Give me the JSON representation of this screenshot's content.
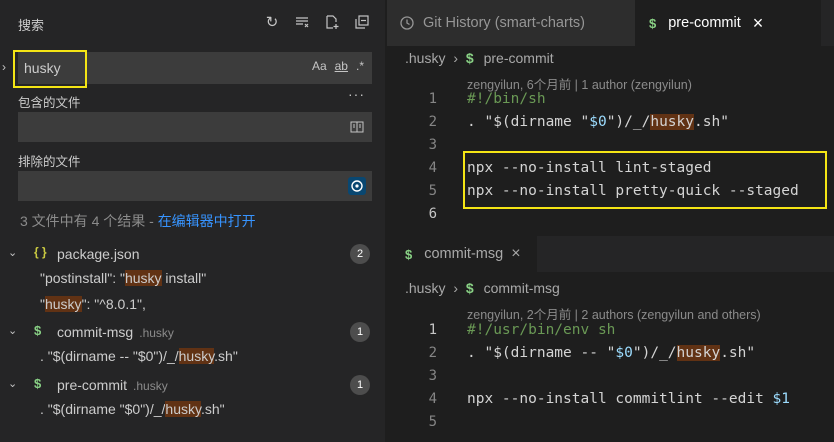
{
  "sidebar": {
    "title": "搜索",
    "actions": [
      {
        "icon": "refresh-icon",
        "glyph": "↻"
      },
      {
        "icon": "clear-results-icon",
        "glyph": "≡"
      },
      {
        "icon": "new-search-editor-icon",
        "glyph": "+"
      },
      {
        "icon": "collapse-all-icon",
        "glyph": "⊟"
      }
    ],
    "search": {
      "value": "husky",
      "options": [
        "Aa",
        "ab",
        ".*"
      ]
    },
    "more_icon": "···",
    "include_label": "包含的文件",
    "exclude_label": "排除的文件",
    "summary": "3 文件中有 4 个结果 - ",
    "summary_link": "在编辑器中打开",
    "results": [
      {
        "icon": "{ }",
        "name": "package.json",
        "dir": "",
        "count": "2",
        "lines": [
          {
            "pre": "\"postinstall\": \"",
            "match": "husky",
            "post": " install\""
          },
          {
            "pre": "\"",
            "match": "husky",
            "post": "\": \"^8.0.1\","
          }
        ]
      },
      {
        "icon": "$",
        "name": "commit-msg",
        "dir": ".husky",
        "count": "1",
        "lines": [
          {
            "pre": ". \"$(dirname -- \"$0\")/_/",
            "match": "husky",
            "post": ".sh\""
          }
        ]
      },
      {
        "icon": "$",
        "name": "pre-commit",
        "dir": ".husky",
        "count": "1",
        "lines": [
          {
            "pre": ". \"$(dirname \"$0\")/_/",
            "match": "husky",
            "post": ".sh\""
          }
        ]
      }
    ]
  },
  "editor": {
    "tabs": [
      {
        "label": "Git History (smart-charts)",
        "icon": "history-icon",
        "active": false
      },
      {
        "label": "pre-commit",
        "icon": "$",
        "active": true,
        "close": "×"
      }
    ],
    "pane1": {
      "breadcrumb_dir": ".husky",
      "breadcrumb_file": "pre-commit",
      "blame": "zengyilun, 6个月前 | 1 author (zengyilun)",
      "line_numbers": [
        "1",
        "2",
        "3",
        "4",
        "5",
        "6"
      ]
    },
    "pane2": {
      "tab_label": "commit-msg",
      "tab_icon": "$",
      "tab_close": "×",
      "breadcrumb_dir": ".husky",
      "breadcrumb_file": "commit-msg",
      "blame": "zengyilun, 2个月前 | 2 authors (zengyilun and others)",
      "line_numbers": [
        "1",
        "2",
        "3",
        "4",
        "5"
      ]
    },
    "pre_commit_code": {
      "l1": "#!/bin/sh",
      "l2_a": ". \"$(dirname \"",
      "l2_var": "$0",
      "l2_b": "\")/_/",
      "l2_match": "husky",
      "l2_c": ".sh\"",
      "l4": "npx --no-install lint-staged",
      "l5": "npx --no-install pretty-quick --staged"
    },
    "commit_msg_code": {
      "l1": "#!/usr/bin/env sh",
      "l2_a": ". \"$(dirname -- \"",
      "l2_var": "$0",
      "l2_b": "\")/_/",
      "l2_match": "husky",
      "l2_c": ".sh\"",
      "l4_a": "npx --no-install commitlint --edit ",
      "l4_var": "$1"
    }
  }
}
